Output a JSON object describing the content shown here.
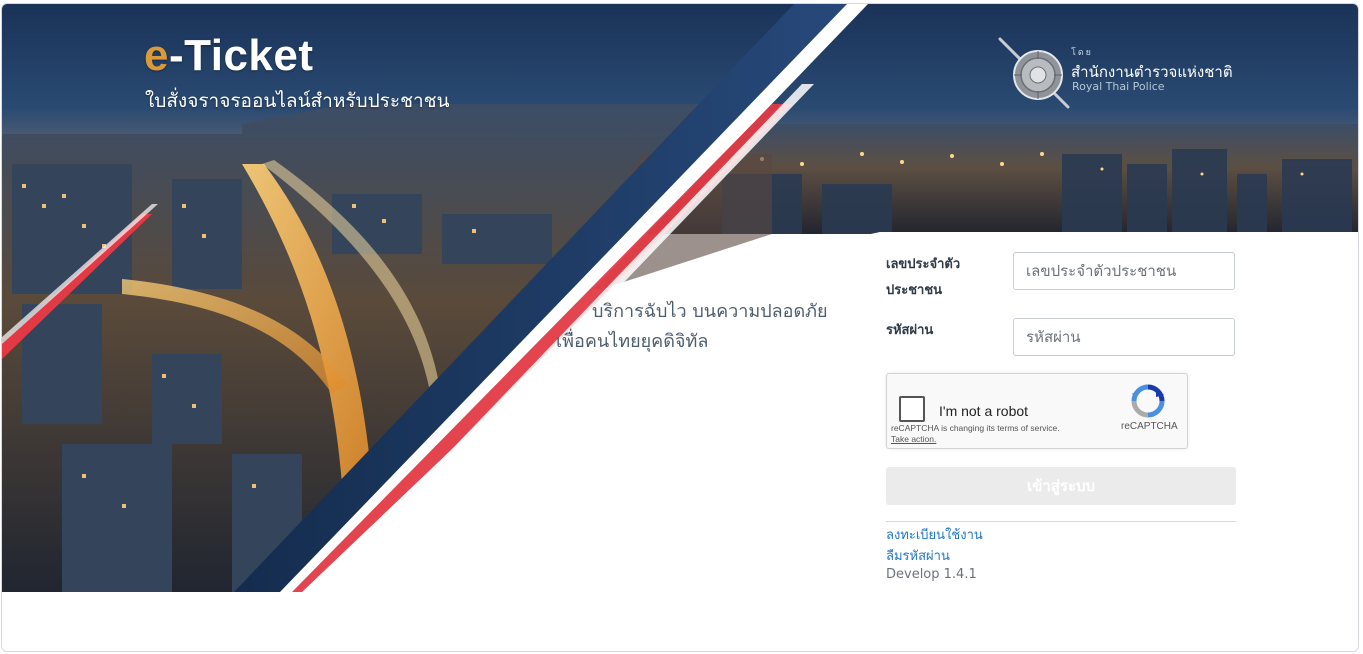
{
  "brand": {
    "title_accent": "e",
    "title_rest": "-Ticket",
    "subtitle": "ใบสั่งจราจรออนไลน์สำหรับประชาชน",
    "accent_color": "#d99a3b"
  },
  "agency": {
    "by": "โดย",
    "name": "สำนักงานตำรวจแห่งชาติ",
    "name_en": "Royal Thai Police",
    "logo_icon": "royal-thai-police-emblem-icon"
  },
  "tagline": {
    "line1": "บริการฉับไว บนความปลอดภัย",
    "line2": "เพื่อคนไทยยุคดิจิทัล"
  },
  "form": {
    "id_label": "เลขประจำตัวประชาชน",
    "id_placeholder": "เลขประจำตัวประชาชน",
    "password_label": "รหัสผ่าน",
    "password_placeholder": "รหัสผ่าน",
    "login_label": "เข้าสู่ระบบ"
  },
  "captcha": {
    "label": "I'm not a robot",
    "notice": "reCAPTCHA is changing its terms of service.",
    "action": "Take action.",
    "brand": "reCAPTCHA"
  },
  "links": {
    "register": "ลงทะเบียนใช้งาน",
    "forgot_password": "ลืมรหัสผ่าน"
  },
  "version": "Develop 1.4.1",
  "colors": {
    "navy": "#1c3a63",
    "red_stripe": "#e23a44",
    "link": "#1f78c8"
  }
}
